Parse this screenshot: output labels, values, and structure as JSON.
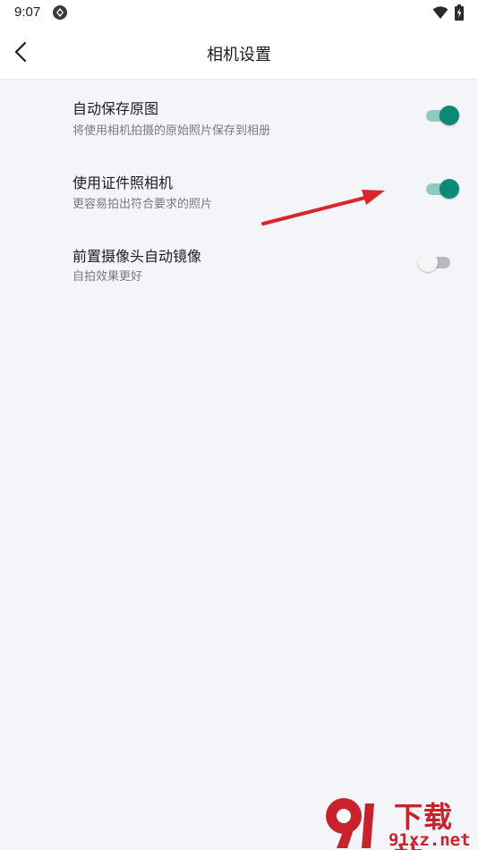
{
  "status_bar": {
    "time": "9:07",
    "notification_icon": "android-icon",
    "wifi_icon": "wifi-icon",
    "battery_icon": "battery-charging-icon"
  },
  "app_bar": {
    "back_icon": "chevron-left-icon",
    "title": "相机设置"
  },
  "settings": [
    {
      "title": "自动保存原图",
      "description": "将使用相机拍摄的原始照片保存到相册",
      "enabled": true
    },
    {
      "title": "使用证件照相机",
      "description": "更容易拍出符合要求的照片",
      "enabled": true
    },
    {
      "title": "前置摄像头自动镜像",
      "description": "自拍效果更好",
      "enabled": false
    }
  ],
  "colors": {
    "accent": "#0b8a76",
    "accent_track": "#8fcac2",
    "background": "#f4f5f9",
    "annotation_arrow": "#d9262b"
  },
  "watermark": {
    "logo_text": "下载站",
    "domain": "91xz.net"
  }
}
